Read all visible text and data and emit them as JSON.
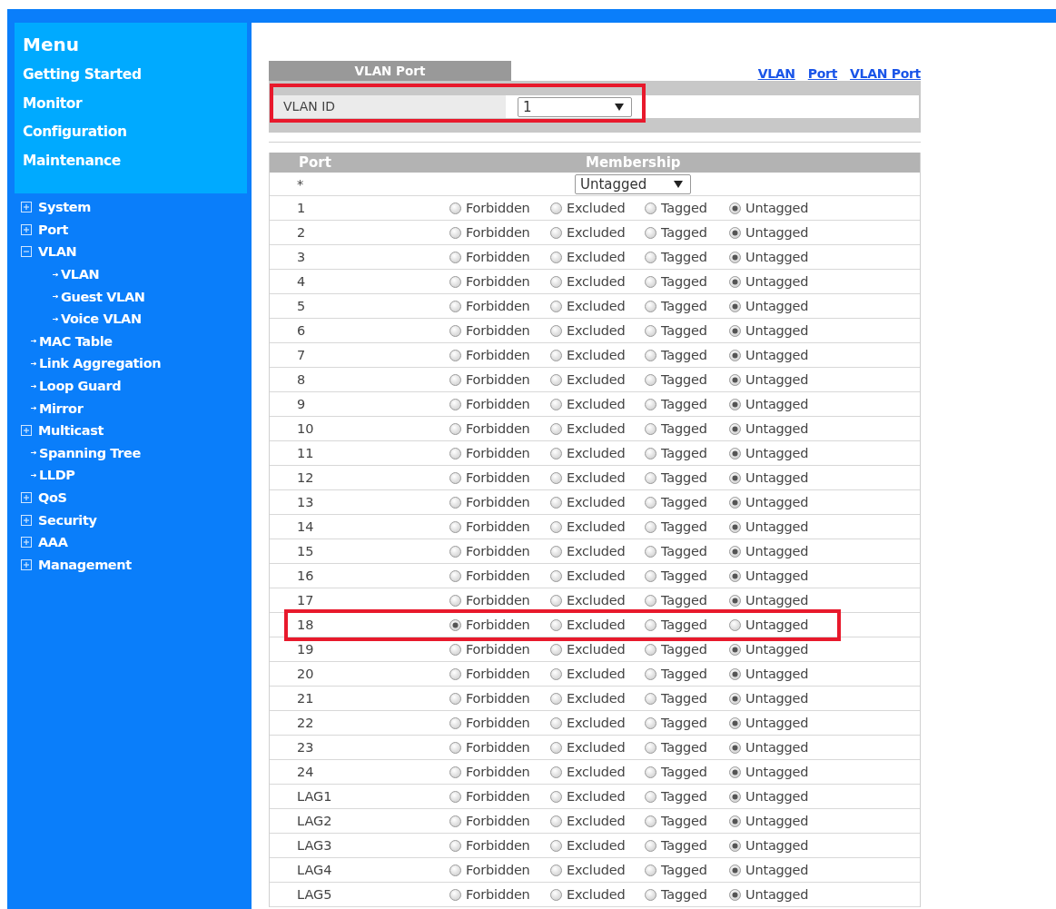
{
  "sidebar": {
    "title": "Menu",
    "items": [
      "Getting Started",
      "Monitor",
      "Configuration",
      "Maintenance"
    ],
    "tree": [
      {
        "label": "System",
        "kind": "group",
        "expanded": false
      },
      {
        "label": "Port",
        "kind": "group",
        "expanded": false
      },
      {
        "label": "VLAN",
        "kind": "group",
        "expanded": true,
        "children": [
          {
            "label": "VLAN",
            "kind": "link"
          },
          {
            "label": "Guest VLAN",
            "kind": "link"
          },
          {
            "label": "Voice VLAN",
            "kind": "link"
          }
        ]
      },
      {
        "label": "MAC Table",
        "kind": "link"
      },
      {
        "label": "Link Aggregation",
        "kind": "link"
      },
      {
        "label": "Loop Guard",
        "kind": "link"
      },
      {
        "label": "Mirror",
        "kind": "link"
      },
      {
        "label": "Multicast",
        "kind": "group",
        "expanded": false
      },
      {
        "label": "Spanning Tree",
        "kind": "link"
      },
      {
        "label": "LLDP",
        "kind": "link"
      },
      {
        "label": "QoS",
        "kind": "group",
        "expanded": false
      },
      {
        "label": "Security",
        "kind": "group",
        "expanded": false
      },
      {
        "label": "AAA",
        "kind": "group",
        "expanded": false
      },
      {
        "label": "Management",
        "kind": "group",
        "expanded": false
      }
    ]
  },
  "panel": {
    "tab": "VLAN Port",
    "links": [
      "VLAN",
      "Port",
      "VLAN Port"
    ],
    "vlan_id": {
      "label": "VLAN ID",
      "value": "1",
      "highlighted": true
    }
  },
  "table": {
    "columns": [
      "Port",
      "Membership"
    ],
    "all_row": {
      "port": "*",
      "value": "Untagged"
    },
    "rows": [
      {
        "port": "1",
        "highlighted": false,
        "options": [
          {
            "label": "Forbidden",
            "selected": false
          },
          {
            "label": "Excluded",
            "selected": false
          },
          {
            "label": "Tagged",
            "selected": false
          },
          {
            "label": "Untagged",
            "selected": true
          }
        ]
      },
      {
        "port": "2",
        "highlighted": false,
        "options": [
          {
            "label": "Forbidden",
            "selected": false
          },
          {
            "label": "Excluded",
            "selected": false
          },
          {
            "label": "Tagged",
            "selected": false
          },
          {
            "label": "Untagged",
            "selected": true
          }
        ]
      },
      {
        "port": "3",
        "highlighted": false,
        "options": [
          {
            "label": "Forbidden",
            "selected": false
          },
          {
            "label": "Excluded",
            "selected": false
          },
          {
            "label": "Tagged",
            "selected": false
          },
          {
            "label": "Untagged",
            "selected": true
          }
        ]
      },
      {
        "port": "4",
        "highlighted": false,
        "options": [
          {
            "label": "Forbidden",
            "selected": false
          },
          {
            "label": "Excluded",
            "selected": false
          },
          {
            "label": "Tagged",
            "selected": false
          },
          {
            "label": "Untagged",
            "selected": true
          }
        ]
      },
      {
        "port": "5",
        "highlighted": false,
        "options": [
          {
            "label": "Forbidden",
            "selected": false
          },
          {
            "label": "Excluded",
            "selected": false
          },
          {
            "label": "Tagged",
            "selected": false
          },
          {
            "label": "Untagged",
            "selected": true
          }
        ]
      },
      {
        "port": "6",
        "highlighted": false,
        "options": [
          {
            "label": "Forbidden",
            "selected": false
          },
          {
            "label": "Excluded",
            "selected": false
          },
          {
            "label": "Tagged",
            "selected": false
          },
          {
            "label": "Untagged",
            "selected": true
          }
        ]
      },
      {
        "port": "7",
        "highlighted": false,
        "options": [
          {
            "label": "Forbidden",
            "selected": false
          },
          {
            "label": "Excluded",
            "selected": false
          },
          {
            "label": "Tagged",
            "selected": false
          },
          {
            "label": "Untagged",
            "selected": true
          }
        ]
      },
      {
        "port": "8",
        "highlighted": false,
        "options": [
          {
            "label": "Forbidden",
            "selected": false
          },
          {
            "label": "Excluded",
            "selected": false
          },
          {
            "label": "Tagged",
            "selected": false
          },
          {
            "label": "Untagged",
            "selected": true
          }
        ]
      },
      {
        "port": "9",
        "highlighted": false,
        "options": [
          {
            "label": "Forbidden",
            "selected": false
          },
          {
            "label": "Excluded",
            "selected": false
          },
          {
            "label": "Tagged",
            "selected": false
          },
          {
            "label": "Untagged",
            "selected": true
          }
        ]
      },
      {
        "port": "10",
        "highlighted": false,
        "options": [
          {
            "label": "Forbidden",
            "selected": false
          },
          {
            "label": "Excluded",
            "selected": false
          },
          {
            "label": "Tagged",
            "selected": false
          },
          {
            "label": "Untagged",
            "selected": true
          }
        ]
      },
      {
        "port": "11",
        "highlighted": false,
        "options": [
          {
            "label": "Forbidden",
            "selected": false
          },
          {
            "label": "Excluded",
            "selected": false
          },
          {
            "label": "Tagged",
            "selected": false
          },
          {
            "label": "Untagged",
            "selected": true
          }
        ]
      },
      {
        "port": "12",
        "highlighted": false,
        "options": [
          {
            "label": "Forbidden",
            "selected": false
          },
          {
            "label": "Excluded",
            "selected": false
          },
          {
            "label": "Tagged",
            "selected": false
          },
          {
            "label": "Untagged",
            "selected": true
          }
        ]
      },
      {
        "port": "13",
        "highlighted": false,
        "options": [
          {
            "label": "Forbidden",
            "selected": false
          },
          {
            "label": "Excluded",
            "selected": false
          },
          {
            "label": "Tagged",
            "selected": false
          },
          {
            "label": "Untagged",
            "selected": true
          }
        ]
      },
      {
        "port": "14",
        "highlighted": false,
        "options": [
          {
            "label": "Forbidden",
            "selected": false
          },
          {
            "label": "Excluded",
            "selected": false
          },
          {
            "label": "Tagged",
            "selected": false
          },
          {
            "label": "Untagged",
            "selected": true
          }
        ]
      },
      {
        "port": "15",
        "highlighted": false,
        "options": [
          {
            "label": "Forbidden",
            "selected": false
          },
          {
            "label": "Excluded",
            "selected": false
          },
          {
            "label": "Tagged",
            "selected": false
          },
          {
            "label": "Untagged",
            "selected": true
          }
        ]
      },
      {
        "port": "16",
        "highlighted": false,
        "options": [
          {
            "label": "Forbidden",
            "selected": false
          },
          {
            "label": "Excluded",
            "selected": false
          },
          {
            "label": "Tagged",
            "selected": false
          },
          {
            "label": "Untagged",
            "selected": true
          }
        ]
      },
      {
        "port": "17",
        "highlighted": false,
        "options": [
          {
            "label": "Forbidden",
            "selected": false
          },
          {
            "label": "Excluded",
            "selected": false
          },
          {
            "label": "Tagged",
            "selected": false
          },
          {
            "label": "Untagged",
            "selected": true
          }
        ]
      },
      {
        "port": "18",
        "highlighted": true,
        "options": [
          {
            "label": "Forbidden",
            "selected": true
          },
          {
            "label": "Excluded",
            "selected": false
          },
          {
            "label": "Tagged",
            "selected": false
          },
          {
            "label": "Untagged",
            "selected": false
          }
        ]
      },
      {
        "port": "19",
        "highlighted": false,
        "options": [
          {
            "label": "Forbidden",
            "selected": false
          },
          {
            "label": "Excluded",
            "selected": false
          },
          {
            "label": "Tagged",
            "selected": false
          },
          {
            "label": "Untagged",
            "selected": true
          }
        ]
      },
      {
        "port": "20",
        "highlighted": false,
        "options": [
          {
            "label": "Forbidden",
            "selected": false
          },
          {
            "label": "Excluded",
            "selected": false
          },
          {
            "label": "Tagged",
            "selected": false
          },
          {
            "label": "Untagged",
            "selected": true
          }
        ]
      },
      {
        "port": "21",
        "highlighted": false,
        "options": [
          {
            "label": "Forbidden",
            "selected": false
          },
          {
            "label": "Excluded",
            "selected": false
          },
          {
            "label": "Tagged",
            "selected": false
          },
          {
            "label": "Untagged",
            "selected": true
          }
        ]
      },
      {
        "port": "22",
        "highlighted": false,
        "options": [
          {
            "label": "Forbidden",
            "selected": false
          },
          {
            "label": "Excluded",
            "selected": false
          },
          {
            "label": "Tagged",
            "selected": false
          },
          {
            "label": "Untagged",
            "selected": true
          }
        ]
      },
      {
        "port": "23",
        "highlighted": false,
        "options": [
          {
            "label": "Forbidden",
            "selected": false
          },
          {
            "label": "Excluded",
            "selected": false
          },
          {
            "label": "Tagged",
            "selected": false
          },
          {
            "label": "Untagged",
            "selected": true
          }
        ]
      },
      {
        "port": "24",
        "highlighted": false,
        "options": [
          {
            "label": "Forbidden",
            "selected": false
          },
          {
            "label": "Excluded",
            "selected": false
          },
          {
            "label": "Tagged",
            "selected": false
          },
          {
            "label": "Untagged",
            "selected": true
          }
        ]
      },
      {
        "port": "LAG1",
        "highlighted": false,
        "options": [
          {
            "label": "Forbidden",
            "selected": false
          },
          {
            "label": "Excluded",
            "selected": false
          },
          {
            "label": "Tagged",
            "selected": false
          },
          {
            "label": "Untagged",
            "selected": true
          }
        ]
      },
      {
        "port": "LAG2",
        "highlighted": false,
        "options": [
          {
            "label": "Forbidden",
            "selected": false
          },
          {
            "label": "Excluded",
            "selected": false
          },
          {
            "label": "Tagged",
            "selected": false
          },
          {
            "label": "Untagged",
            "selected": true
          }
        ]
      },
      {
        "port": "LAG3",
        "highlighted": false,
        "options": [
          {
            "label": "Forbidden",
            "selected": false
          },
          {
            "label": "Excluded",
            "selected": false
          },
          {
            "label": "Tagged",
            "selected": false
          },
          {
            "label": "Untagged",
            "selected": true
          }
        ]
      },
      {
        "port": "LAG4",
        "highlighted": false,
        "options": [
          {
            "label": "Forbidden",
            "selected": false
          },
          {
            "label": "Excluded",
            "selected": false
          },
          {
            "label": "Tagged",
            "selected": false
          },
          {
            "label": "Untagged",
            "selected": true
          }
        ]
      },
      {
        "port": "LAG5",
        "highlighted": false,
        "options": [
          {
            "label": "Forbidden",
            "selected": false
          },
          {
            "label": "Excluded",
            "selected": false
          },
          {
            "label": "Tagged",
            "selected": false
          },
          {
            "label": "Untagged",
            "selected": true
          }
        ]
      }
    ]
  }
}
